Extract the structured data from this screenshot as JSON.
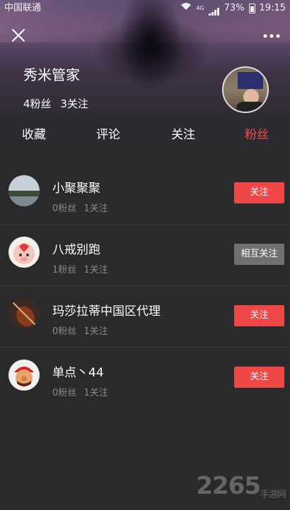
{
  "status_bar": {
    "carrier": "中国联通",
    "battery": "73%",
    "time": "19:15",
    "network": "4G"
  },
  "header": {
    "username": "秀米管家",
    "followers_label": "4粉丝",
    "following_label": "3关注"
  },
  "tabs": [
    {
      "label": "收藏",
      "active": false
    },
    {
      "label": "评论",
      "active": false
    },
    {
      "label": "关注",
      "active": false
    },
    {
      "label": "粉丝",
      "active": true
    }
  ],
  "list": [
    {
      "name": "小聚聚聚",
      "fans": "0粉丝",
      "follows": "1关注",
      "button": "关注",
      "button_type": "follow"
    },
    {
      "name": "八戒别跑",
      "fans": "1粉丝",
      "follows": "1关注",
      "button": "相互关注",
      "button_type": "mutual"
    },
    {
      "name": "玛莎拉蒂中国区代理",
      "fans": "0粉丝",
      "follows": "1关注",
      "button": "关注",
      "button_type": "follow"
    },
    {
      "name": "单点丶44",
      "fans": "0粉丝",
      "follows": "1关注",
      "button": "关注",
      "button_type": "follow"
    }
  ],
  "watermark": {
    "main": "2265",
    "sub": "手游网"
  },
  "colors": {
    "accent": "#f04848",
    "mutual": "#707070",
    "background": "#2a2a2c"
  }
}
